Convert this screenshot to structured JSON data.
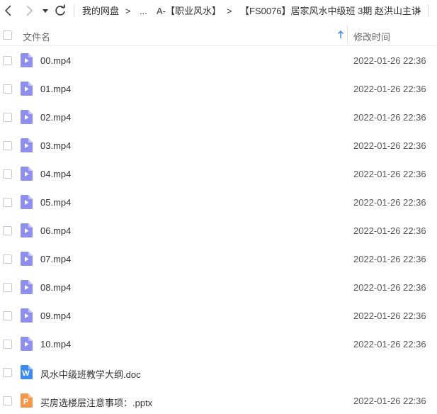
{
  "toolbar": {
    "breadcrumbs": [
      {
        "label": "我的网盘"
      },
      {
        "label": "..."
      },
      {
        "label": "A-【职业风水】"
      },
      {
        "label": "【FS0076】居家风水中级班 3期 赵洪山主讲"
      }
    ],
    "separator": ">"
  },
  "header": {
    "name_label": "文件名",
    "time_label": "修改时间"
  },
  "colors": {
    "video": "#8f8ff0",
    "doc": "#3d8bf2",
    "ppt": "#f5974a"
  },
  "files": [
    {
      "name": "00.mp4",
      "time": "2022-01-26 22:36",
      "icon": "video-file-icon"
    },
    {
      "name": "01.mp4",
      "time": "2022-01-26 22:36",
      "icon": "video-file-icon"
    },
    {
      "name": "02.mp4",
      "time": "2022-01-26 22:36",
      "icon": "video-file-icon"
    },
    {
      "name": "03.mp4",
      "time": "2022-01-26 22:36",
      "icon": "video-file-icon"
    },
    {
      "name": "04.mp4",
      "time": "2022-01-26 22:36",
      "icon": "video-file-icon"
    },
    {
      "name": "05.mp4",
      "time": "2022-01-26 22:36",
      "icon": "video-file-icon"
    },
    {
      "name": "06.mp4",
      "time": "2022-01-26 22:36",
      "icon": "video-file-icon"
    },
    {
      "name": "07.mp4",
      "time": "2022-01-26 22:36",
      "icon": "video-file-icon"
    },
    {
      "name": "08.mp4",
      "time": "2022-01-26 22:36",
      "icon": "video-file-icon"
    },
    {
      "name": "09.mp4",
      "time": "2022-01-26 22:36",
      "icon": "video-file-icon"
    },
    {
      "name": "10.mp4",
      "time": "2022-01-26 22:36",
      "icon": "video-file-icon"
    },
    {
      "name": "风水中级班教学大纲.doc",
      "time": "",
      "icon": "word-file-icon",
      "badge": "W"
    },
    {
      "name": "买房选楼层注意事项：.pptx",
      "time": "2022-01-26 22:36",
      "icon": "ppt-file-icon",
      "badge": "P"
    }
  ]
}
